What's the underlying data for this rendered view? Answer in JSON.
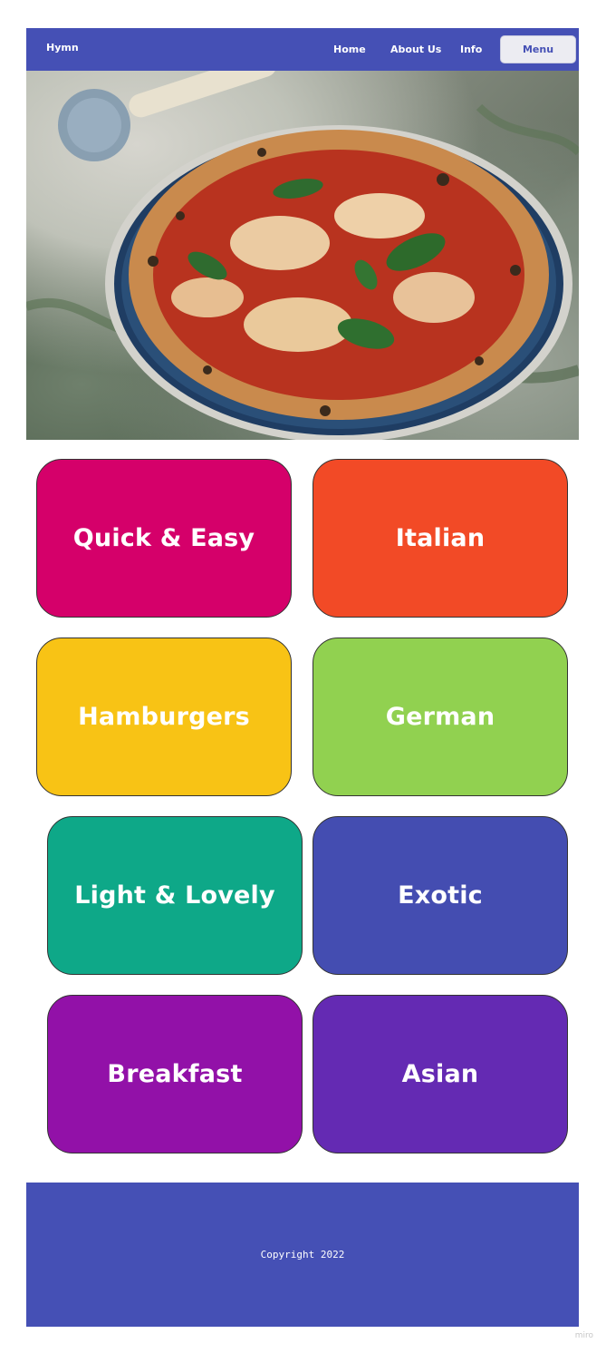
{
  "navbar": {
    "brand": "Hymn",
    "links": [
      "Home",
      "About Us",
      "Info"
    ],
    "menu_button": "Menu"
  },
  "hero": {
    "image_alt_icon": "pizza-photo"
  },
  "categories": [
    {
      "label": "Quick & Easy",
      "color": "#d5006a"
    },
    {
      "label": "Italian",
      "color": "#f24a26"
    },
    {
      "label": "Hamburgers",
      "color": "#f8c315"
    },
    {
      "label": "German",
      "color": "#91d150"
    },
    {
      "label": "Light & Lovely",
      "color": "#0ea888"
    },
    {
      "label": "Exotic",
      "color": "#444db1"
    },
    {
      "label": "Breakfast",
      "color": "#9211a8"
    },
    {
      "label": "Asian",
      "color": "#642ab3"
    }
  ],
  "footer": {
    "copyright": "Copyright 2022"
  },
  "watermark": "miro",
  "colors": {
    "primary": "#4550b5"
  }
}
